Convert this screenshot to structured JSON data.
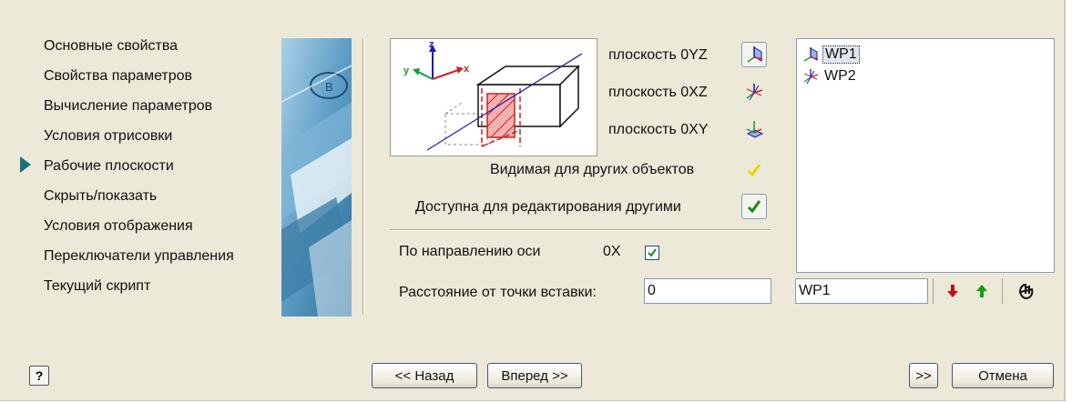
{
  "nav": {
    "items": [
      {
        "label": "Основные свойства"
      },
      {
        "label": "Свойства параметров"
      },
      {
        "label": "Вычисление параметров"
      },
      {
        "label": "Условия отрисовки"
      },
      {
        "label": "Рабочие плоскости"
      },
      {
        "label": "Скрыть/показать"
      },
      {
        "label": "Условия отображения"
      },
      {
        "label": "Переключатели управления"
      },
      {
        "label": "Текущий скрипт"
      }
    ],
    "active_index": 4
  },
  "preview": {
    "axis_z": "z",
    "axis_y": "y",
    "axis_x": "x"
  },
  "planes": {
    "oyz_label": "плоскость 0YZ",
    "oxz_label": "плоскость 0XZ",
    "oxy_label": "плоскость 0XY"
  },
  "options": {
    "visible_label": "Видимая для других объектов",
    "editable_label": "Доступна для редактирования другими",
    "axis_direction_label": "По направлению оси",
    "axis_value": "0X",
    "axis_direction_checked": true,
    "distance_label": "Расстояние от точки вставки:",
    "distance_value": "0"
  },
  "tree": {
    "items": [
      {
        "label": "WP1",
        "selected": true
      },
      {
        "label": "WP2",
        "selected": false
      }
    ],
    "name_value": "WP1"
  },
  "footer": {
    "help_label": "?",
    "back_label": "<< Назад",
    "next_label": "Вперед >>",
    "skip_label": ">>",
    "cancel_label": "Отмена"
  },
  "colors": {
    "dialog_bg": "#ece9d8",
    "axis_z": "#1a1ab0",
    "axis_y": "#1a9a3a",
    "axis_x": "#d02020",
    "check_green": "#1a8a1a",
    "check_yellow": "#e8d800",
    "arrow_red": "#c01010",
    "arrow_green": "#10a010"
  }
}
